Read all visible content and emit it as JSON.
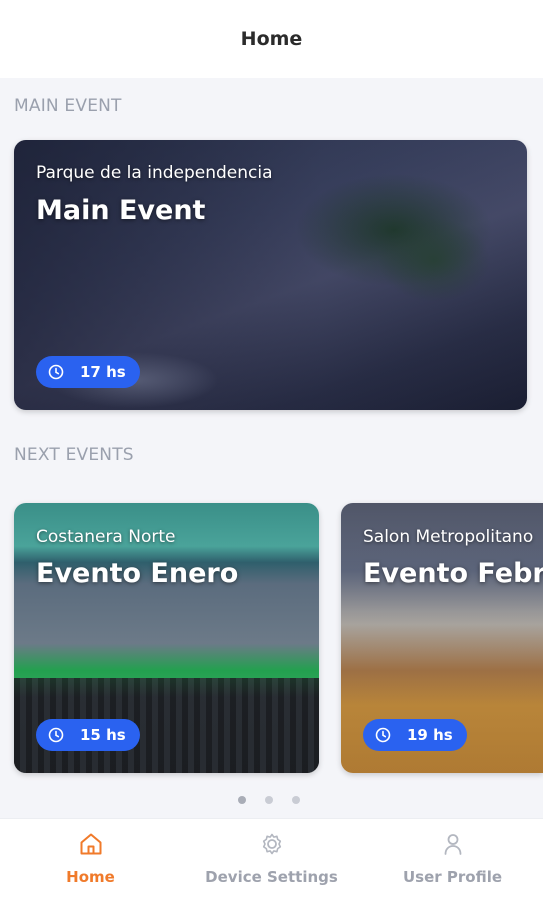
{
  "header": {
    "title": "Home"
  },
  "sections": {
    "main_label": "MAIN EVENT",
    "next_label": "NEXT EVENTS"
  },
  "main_event": {
    "location": "Parque de la independencia",
    "name": "Main Event",
    "time": "17 hs",
    "icon": "clock-icon"
  },
  "next_events": [
    {
      "location": "Costanera Norte",
      "name": "Evento Enero",
      "time": "15 hs",
      "icon": "clock-icon"
    },
    {
      "location": "Salon Metropolitano",
      "name": "Evento Febrero",
      "time": "19 hs",
      "icon": "clock-icon"
    }
  ],
  "pagination": {
    "pages": 3,
    "current": 1
  },
  "tabbar": {
    "items": [
      {
        "label": "Home",
        "icon": "home-icon",
        "active": true
      },
      {
        "label": "Device Settings",
        "icon": "gear-icon",
        "active": false
      },
      {
        "label": "User Profile",
        "icon": "user-icon",
        "active": false
      }
    ]
  },
  "colors": {
    "accent": "#f07a2a",
    "badge": "#2a62f0",
    "inactive": "#9ea2ad"
  }
}
